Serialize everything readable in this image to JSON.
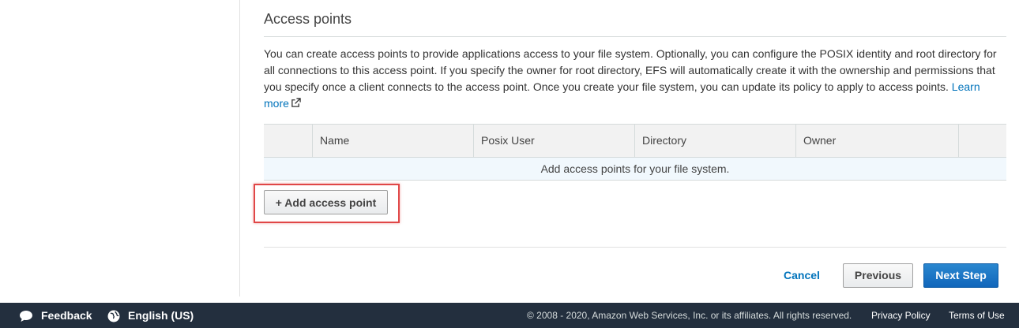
{
  "section": {
    "title": "Access points",
    "description": "You can create access points to provide applications access to your file system. Optionally, you can configure the POSIX identity and root directory for all connections to this access point. If you specify the owner for root directory, EFS will automatically create it with the ownership and permissions that you specify once a client connects to the access point. Once you create your file system, you can update its policy to apply to access points.",
    "learn_more": "Learn more"
  },
  "table": {
    "columns": [
      "",
      "Name",
      "Posix User",
      "Directory",
      "Owner",
      ""
    ],
    "empty_message": "Add access points for your file system."
  },
  "buttons": {
    "add_access_point": "+ Add access point",
    "cancel": "Cancel",
    "previous": "Previous",
    "next": "Next Step"
  },
  "footer": {
    "feedback": "Feedback",
    "language": "English (US)",
    "copyright": "© 2008 - 2020, Amazon Web Services, Inc. or its affiliates. All rights reserved.",
    "privacy": "Privacy Policy",
    "terms": "Terms of Use"
  },
  "colors": {
    "link": "#0073bb",
    "primary_button": "#1166bb",
    "footer_bg": "#232f3e",
    "highlight": "#e04747"
  }
}
